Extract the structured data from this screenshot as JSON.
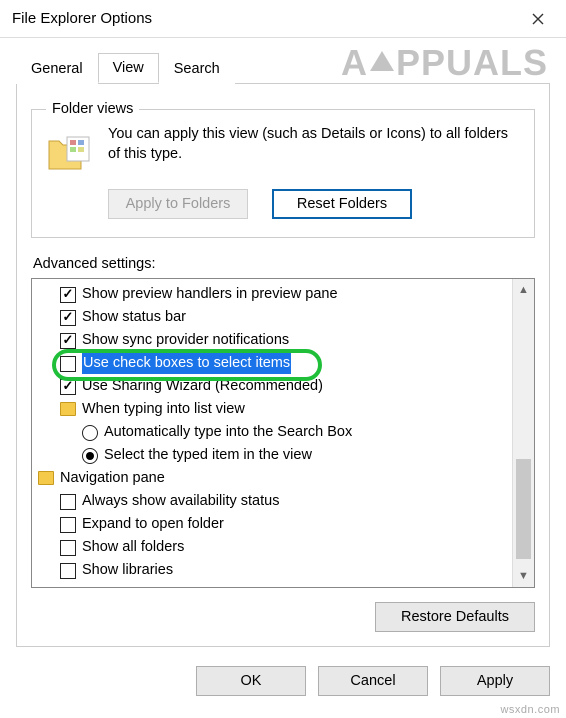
{
  "window": {
    "title": "File Explorer Options"
  },
  "tabs": {
    "general": "General",
    "view": "View",
    "search": "Search",
    "active": "view"
  },
  "folder_views": {
    "legend": "Folder views",
    "text": "You can apply this view (such as Details or Icons) to all folders of this type.",
    "apply_btn": "Apply to Folders",
    "reset_btn": "Reset Folders"
  },
  "advanced": {
    "label": "Advanced settings:",
    "items": [
      {
        "kind": "check",
        "indent": 1,
        "checked": true,
        "label": "Show preview handlers in preview pane"
      },
      {
        "kind": "check",
        "indent": 1,
        "checked": true,
        "label": "Show status bar"
      },
      {
        "kind": "check",
        "indent": 1,
        "checked": true,
        "label": "Show sync provider notifications"
      },
      {
        "kind": "check",
        "indent": 1,
        "checked": false,
        "label": "Use check boxes to select items",
        "highlight": true
      },
      {
        "kind": "check",
        "indent": 1,
        "checked": true,
        "label": "Use Sharing Wizard (Recommended)"
      },
      {
        "kind": "folder",
        "indent": 1,
        "label": "When typing into list view"
      },
      {
        "kind": "radio",
        "indent": 2,
        "checked": false,
        "label": "Automatically type into the Search Box"
      },
      {
        "kind": "radio",
        "indent": 2,
        "checked": true,
        "label": "Select the typed item in the view"
      },
      {
        "kind": "folder",
        "indent": 0,
        "label": "Navigation pane"
      },
      {
        "kind": "check",
        "indent": 1,
        "checked": false,
        "label": "Always show availability status"
      },
      {
        "kind": "check",
        "indent": 1,
        "checked": false,
        "label": "Expand to open folder"
      },
      {
        "kind": "check",
        "indent": 1,
        "checked": false,
        "label": "Show all folders"
      },
      {
        "kind": "check",
        "indent": 1,
        "checked": false,
        "label": "Show libraries"
      }
    ]
  },
  "buttons": {
    "restore_defaults": "Restore Defaults",
    "ok": "OK",
    "cancel": "Cancel",
    "apply": "Apply"
  },
  "watermark": "wsxdn.com",
  "brand": {
    "pre": "A",
    "post": "PPUALS"
  }
}
